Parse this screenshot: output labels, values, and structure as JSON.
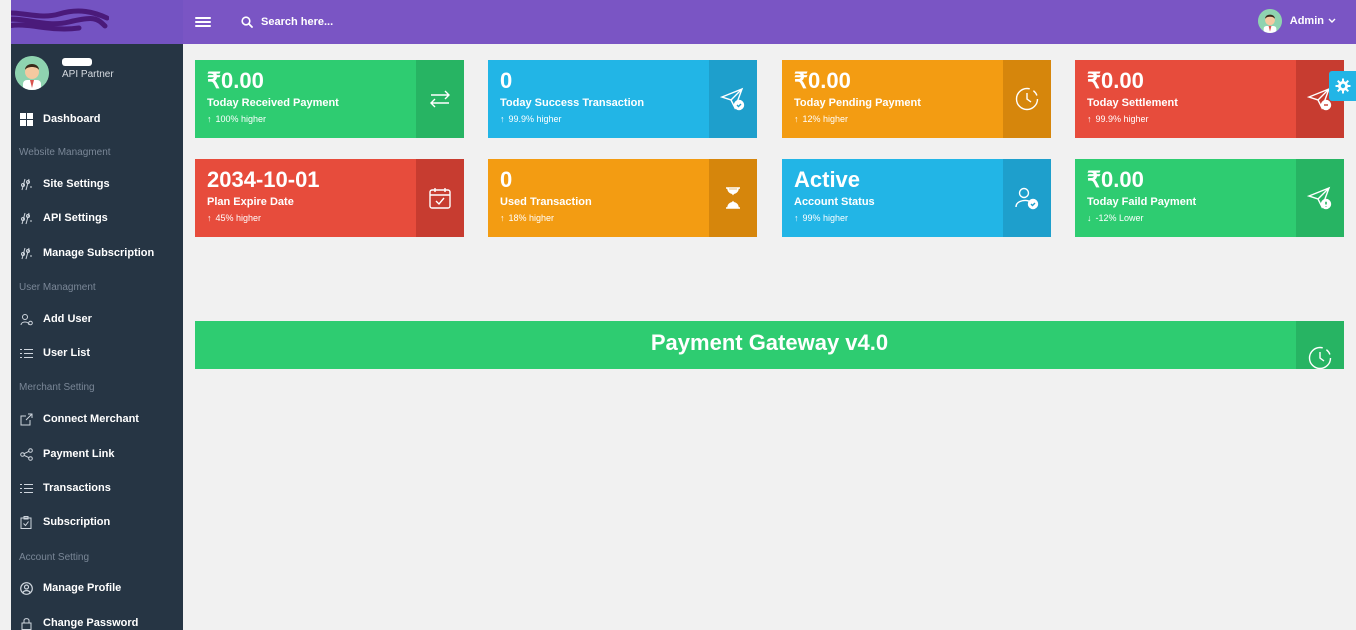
{
  "sidebar": {
    "profile_role": "API Partner",
    "dashboard": "Dashboard",
    "sections": {
      "website": "Website Managment",
      "user": "User Managment",
      "merchant": "Merchant Setting",
      "account": "Account Setting"
    },
    "items": {
      "site_settings": "Site Settings",
      "api_settings": "API Settings",
      "manage_subscription": "Manage Subscription",
      "add_user": "Add User",
      "user_list": "User List",
      "connect_merchant": "Connect Merchant",
      "payment_link": "Payment Link",
      "transactions": "Transactions",
      "subscription": "Subscription",
      "manage_profile": "Manage Profile",
      "change_password": "Change Password"
    }
  },
  "topbar": {
    "search_placeholder": "Search here...",
    "admin_name": "Admin"
  },
  "cards": [
    {
      "value": "₹0.00",
      "title": "Today Received Payment",
      "trend": "100% higher",
      "arrow": "up",
      "color": "#2ecc71",
      "icon": "transfer-arrows-icon"
    },
    {
      "value": "0",
      "title": "Today Success Transaction",
      "trend": "99.9% higher",
      "arrow": "up",
      "color": "#22b5e6",
      "icon": "send-check-icon"
    },
    {
      "value": "₹0.00",
      "title": "Today Pending Payment",
      "trend": "12% higher",
      "arrow": "up",
      "color": "#f39c12",
      "icon": "clock-icon"
    },
    {
      "value": "₹0.00",
      "title": "Today Settlement",
      "trend": "99.9% higher",
      "arrow": "up",
      "color": "#e74c3c",
      "icon": "send-minus-icon"
    },
    {
      "value": "2034-10-01",
      "title": "Plan Expire Date",
      "trend": "45% higher",
      "arrow": "up",
      "color": "#e74c3c",
      "icon": "calendar-check-icon"
    },
    {
      "value": "0",
      "title": "Used Transaction",
      "trend": "18% higher",
      "arrow": "up",
      "color": "#f39c12",
      "icon": "hourglass-icon"
    },
    {
      "value": "Active",
      "title": "Account Status",
      "trend": "99% higher",
      "arrow": "up",
      "color": "#22b5e6",
      "icon": "user-check-icon"
    },
    {
      "value": "₹0.00",
      "title": "Today Faild Payment",
      "trend": "-12% Lower",
      "arrow": "down",
      "color": "#2ecc71",
      "icon": "send-alert-icon"
    }
  ],
  "banner": {
    "title": "Payment Gateway v4.0"
  }
}
